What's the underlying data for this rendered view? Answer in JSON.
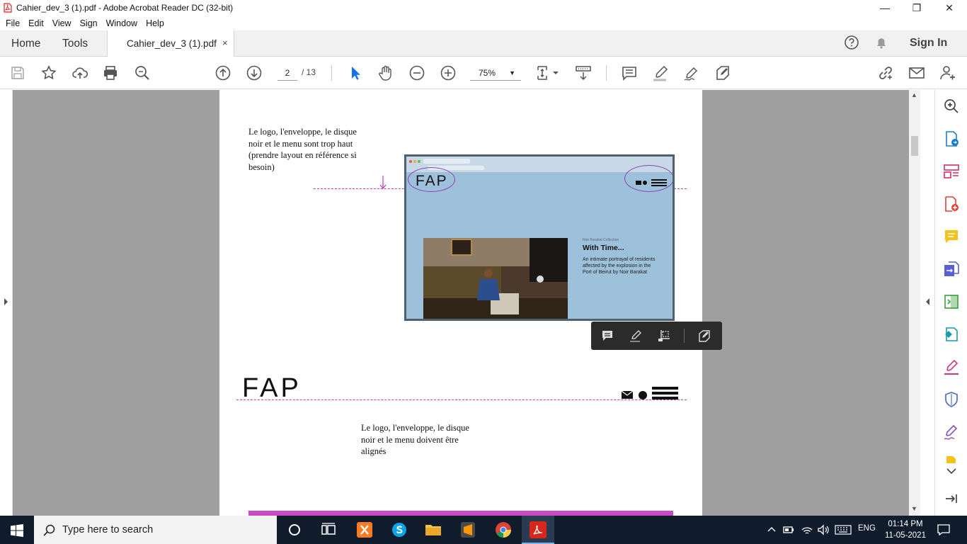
{
  "window": {
    "title": "Cahier_dev_3 (1).pdf - Adobe Acrobat Reader DC (32-bit)",
    "controls": {
      "minimize": "—",
      "maximize": "❐",
      "close": "✕"
    }
  },
  "menu": [
    "File",
    "Edit",
    "View",
    "Sign",
    "Window",
    "Help"
  ],
  "tabs": {
    "home": "Home",
    "tools": "Tools",
    "document": "Cahier_dev_3 (1).pdf",
    "close": "×",
    "sign_in": "Sign In"
  },
  "toolbar": {
    "page_current": "2",
    "page_total": "/ 13",
    "zoom": "75%",
    "zoom_caret": "▼"
  },
  "page": {
    "note_top": [
      "Le logo, l'enveloppe, le disque",
      "noir et le menu sont trop haut",
      "(prendre layout en référence si",
      "besoin)"
    ],
    "note_bottom": [
      "Le logo, l'enveloppe, le disque",
      "noir et le menu doivent être",
      "alignés"
    ],
    "logo_large": "FAP",
    "embedded_shot": {
      "logo": "FAP",
      "kicker": "Noir Barakat Collection",
      "headline": "With Time...",
      "description": "An intimate portrayal of residents affected by the explosion in the Port of Beirut by Noir Barakat"
    }
  },
  "scrollbar": {
    "up": "▲",
    "down": "▼"
  },
  "taskbar": {
    "search_placeholder": "Type here to search",
    "language": "ENG",
    "time": "01:14 PM",
    "date": "11-05-2021"
  },
  "colors": {
    "annotation_dash": "#c23cb6",
    "annotation_oval": "#8c3fb5",
    "pink_bar": "#c94ac7",
    "screenshot_bg": "#9dc1db",
    "acrobat_red": "#d9261c",
    "taskbar": "#101c2c"
  }
}
